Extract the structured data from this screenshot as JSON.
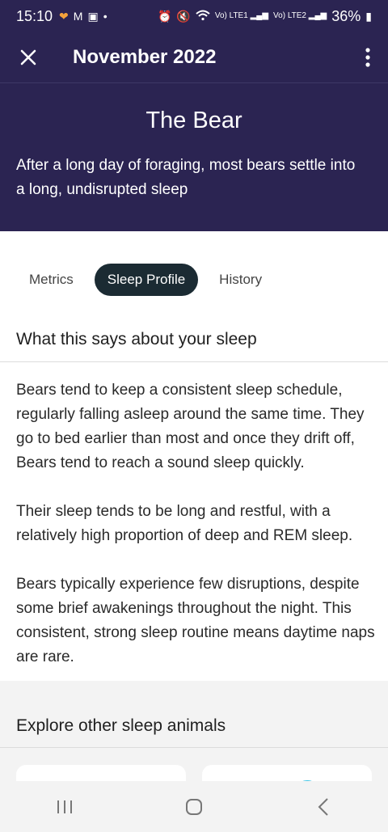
{
  "status_bar": {
    "time": "15:10",
    "battery": "36%",
    "network_a": "Vo) LTE1",
    "network_b": "Vo) LTE2"
  },
  "app_bar": {
    "title": "November 2022"
  },
  "hero": {
    "title": "The Bear",
    "description": "After a long day of foraging, most bears settle into a long, undisrupted sleep"
  },
  "tabs": [
    {
      "label": "Metrics"
    },
    {
      "label": "Sleep Profile"
    },
    {
      "label": "History"
    }
  ],
  "section": {
    "title": "What this says about your sleep",
    "paragraphs": [
      "Bears tend to keep a consistent sleep schedule, regularly falling asleep around the same time. They go to bed earlier than most and once they drift off, Bears tend to reach a sound sleep quickly.",
      "Their sleep tends to be long and restful, with a relatively high proportion of deep and REM sleep.",
      "Bears typically experience few disruptions, despite some brief awakenings throughout the night. This consistent, strong sleep routine means daytime naps are rare."
    ]
  },
  "explore": {
    "title": "Explore other sleep animals"
  },
  "colors": {
    "header_bg": "#2b2452",
    "active_tab": "#1b2b33",
    "accent_circle": "#3ec5e6"
  }
}
